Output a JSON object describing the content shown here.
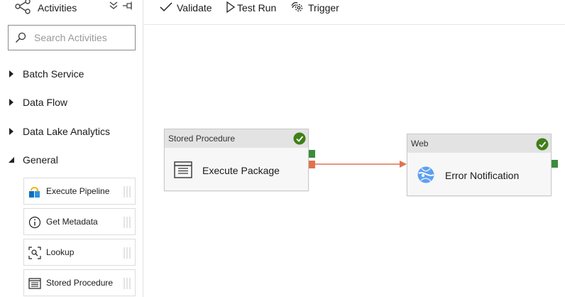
{
  "sidebar": {
    "title": "Activities",
    "search_placeholder": "Search Activities",
    "categories": [
      {
        "label": "Batch Service",
        "expanded": false
      },
      {
        "label": "Data Flow",
        "expanded": false
      },
      {
        "label": "Data Lake Analytics",
        "expanded": false
      },
      {
        "label": "General",
        "expanded": true
      }
    ],
    "general_items": [
      {
        "label": "Execute Pipeline",
        "icon": "execute-pipeline-icon"
      },
      {
        "label": "Get Metadata",
        "icon": "info-icon"
      },
      {
        "label": "Lookup",
        "icon": "lookup-icon"
      },
      {
        "label": "Stored Procedure",
        "icon": "stored-procedure-icon"
      }
    ]
  },
  "toolbar": {
    "validate_label": "Validate",
    "test_run_label": "Test Run",
    "trigger_label": "Trigger"
  },
  "canvas": {
    "nodes": [
      {
        "type": "Stored Procedure",
        "name": "Execute Package",
        "icon": "stored-procedure-icon",
        "status": "succeeded"
      },
      {
        "type": "Web",
        "name": "Error Notification",
        "icon": "web-activity-icon",
        "status": "succeeded"
      }
    ],
    "connection": {
      "from": "Execute Package",
      "to": "Error Notification",
      "condition": "failure"
    }
  },
  "colors": {
    "success_port": "#3c8c3c",
    "failure_port": "#e0734f",
    "check_green": "#3f7f17",
    "accent_blue": "#0078d4"
  }
}
